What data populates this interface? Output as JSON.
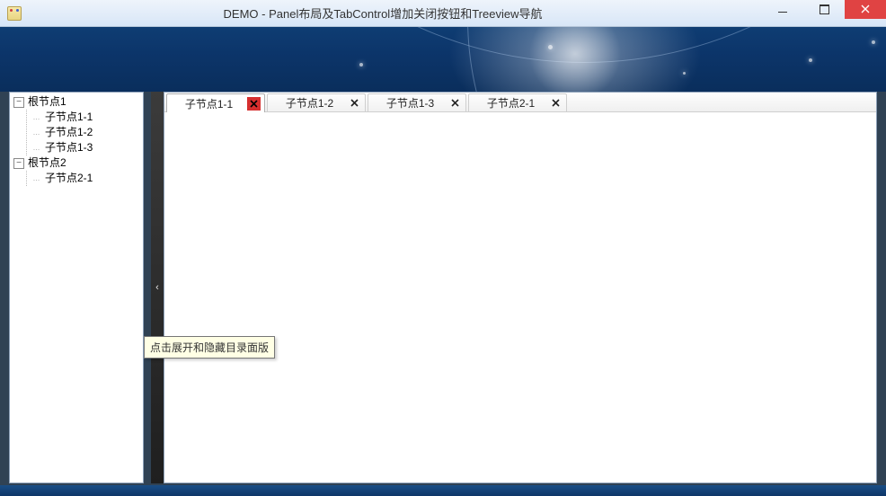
{
  "window": {
    "title": "DEMO - Panel布局及TabControl增加关闭按钮和Treeview导航"
  },
  "tree": {
    "roots": [
      {
        "label": "根节点1",
        "expanded": true,
        "children": [
          {
            "label": "子节点1-1"
          },
          {
            "label": "子节点1-2"
          },
          {
            "label": "子节点1-3"
          }
        ]
      },
      {
        "label": "根节点2",
        "expanded": true,
        "children": [
          {
            "label": "子节点2-1"
          }
        ]
      }
    ]
  },
  "splitter": {
    "tooltip": "点击展开和隐藏目录面版",
    "direction_glyph": "‹"
  },
  "tabs": {
    "active_index": 0,
    "items": [
      {
        "label": "子节点1-1"
      },
      {
        "label": "子节点1-2"
      },
      {
        "label": "子节点1-3"
      },
      {
        "label": "子节点2-1"
      }
    ]
  }
}
